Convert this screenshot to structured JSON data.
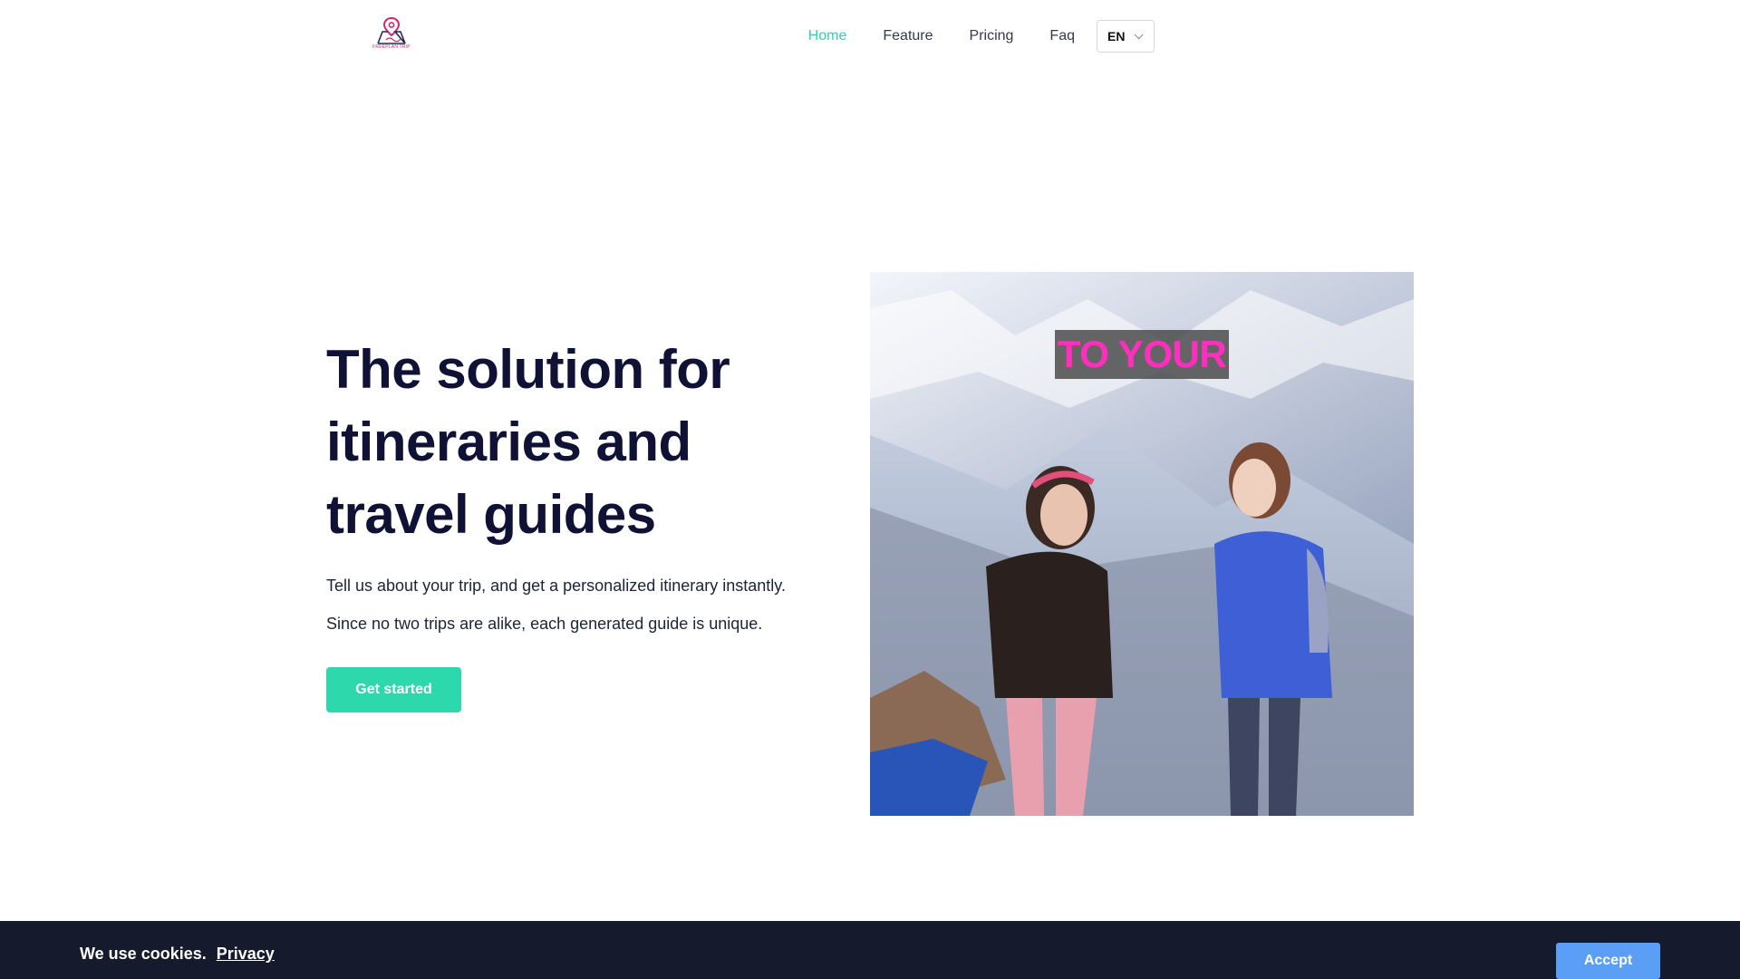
{
  "header": {
    "logo_text": "FREEPLAN TRIP",
    "nav": [
      {
        "label": "Home",
        "active": true
      },
      {
        "label": "Feature",
        "active": false
      },
      {
        "label": "Pricing",
        "active": false
      },
      {
        "label": "Faq",
        "active": false
      }
    ],
    "language": "EN"
  },
  "hero": {
    "title": "The solution for itineraries and travel guides",
    "line1": "Tell us about your trip, and get a personalized itinerary instantly.",
    "line2": "Since no two trips are alike, each generated guide is unique.",
    "cta_label": "Get started"
  },
  "media": {
    "caption": "TO YOUR"
  },
  "cookie": {
    "message": "We use cookies.",
    "link_label": "Privacy",
    "accept_label": "Accept"
  },
  "colors": {
    "accent": "#2ed8ad",
    "active_nav": "#2fd1b0",
    "heading": "#0f1234",
    "cookie_bg": "#151b2d",
    "accept_button": "#5a9ef5",
    "caption_text": "#ff2fbd"
  }
}
